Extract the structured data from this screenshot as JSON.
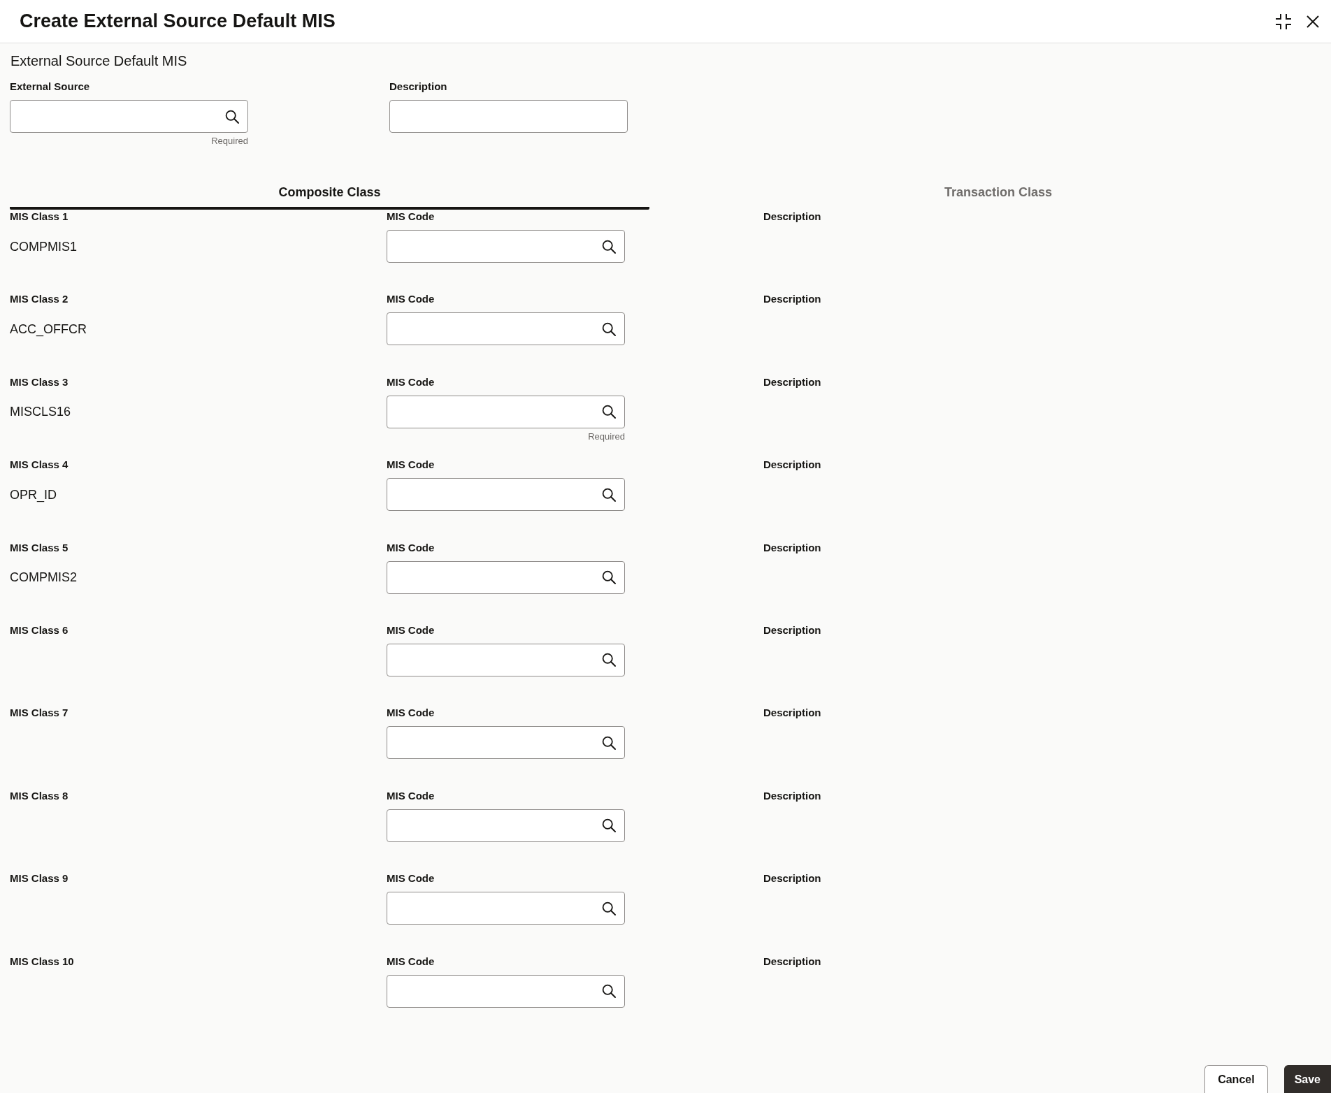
{
  "dialog": {
    "title": "Create External Source Default MIS"
  },
  "section": {
    "title": "External Source Default MIS"
  },
  "fields": [
    {
      "label": "External Source",
      "kind": "lookup",
      "helper_text": "Required"
    },
    {
      "label": "Description",
      "kind": "text"
    }
  ],
  "tabs": [
    {
      "label": "Composite Class",
      "selected": true
    },
    {
      "label": "Transaction Class",
      "selected": false
    }
  ],
  "mis_rows": [
    {
      "class_label": "MIS Class 1",
      "class_value": "COMPMIS1",
      "code_label": "MIS Code",
      "description_label": "Description"
    },
    {
      "class_label": "MIS Class 2",
      "class_value": "ACC_OFFCR",
      "code_label": "MIS Code",
      "description_label": "Description"
    },
    {
      "class_label": "MIS Class 3",
      "class_value": "MISCLS16",
      "code_label": "MIS Code",
      "code_helper_text": "Required",
      "description_label": "Description"
    },
    {
      "class_label": "MIS Class 4",
      "class_value": "OPR_ID",
      "code_label": "MIS Code",
      "description_label": "Description"
    },
    {
      "class_label": "MIS Class 5",
      "class_value": "COMPMIS2",
      "code_label": "MIS Code",
      "description_label": "Description"
    },
    {
      "class_label": "MIS Class 6",
      "code_label": "MIS Code",
      "description_label": "Description"
    },
    {
      "class_label": "MIS Class 7",
      "code_label": "MIS Code",
      "description_label": "Description"
    },
    {
      "class_label": "MIS Class 8",
      "code_label": "MIS Code",
      "description_label": "Description"
    },
    {
      "class_label": "MIS Class 9",
      "code_label": "MIS Code",
      "description_label": "Description"
    },
    {
      "class_label": "MIS Class 10",
      "code_label": "MIS Code",
      "description_label": "Description"
    }
  ],
  "buttons": [
    {
      "label": "Cancel",
      "kind": "secondary"
    },
    {
      "label": "Save",
      "kind": "primary"
    }
  ]
}
